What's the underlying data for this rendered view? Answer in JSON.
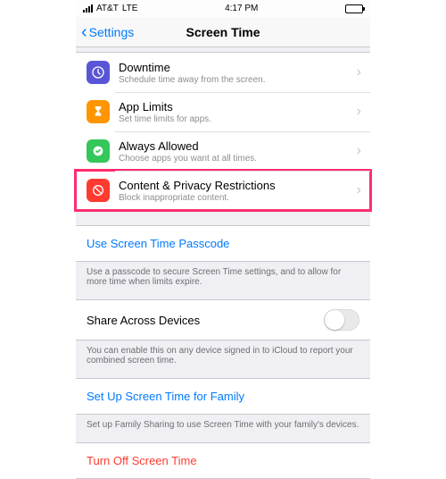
{
  "status": {
    "carrier": "AT&T",
    "net": "LTE",
    "time": "4:17 PM"
  },
  "nav": {
    "back": "Settings",
    "title": "Screen Time"
  },
  "rows": {
    "downtime": {
      "title": "Downtime",
      "sub": "Schedule time away from the screen."
    },
    "applimits": {
      "title": "App Limits",
      "sub": "Set time limits for apps."
    },
    "allowed": {
      "title": "Always Allowed",
      "sub": "Choose apps you want at all times."
    },
    "content": {
      "title": "Content & Privacy Restrictions",
      "sub": "Block inappropriate content."
    }
  },
  "passcode": {
    "link": "Use Screen Time Passcode",
    "footer": "Use a passcode to secure Screen Time settings, and to allow for more time when limits expire."
  },
  "share": {
    "label": "Share Across Devices",
    "footer": "You can enable this on any device signed in to iCloud to report your combined screen time."
  },
  "family": {
    "link": "Set Up Screen Time for Family",
    "footer": "Set up Family Sharing to use Screen Time with your family's devices."
  },
  "turnoff": {
    "link": "Turn Off Screen Time"
  }
}
